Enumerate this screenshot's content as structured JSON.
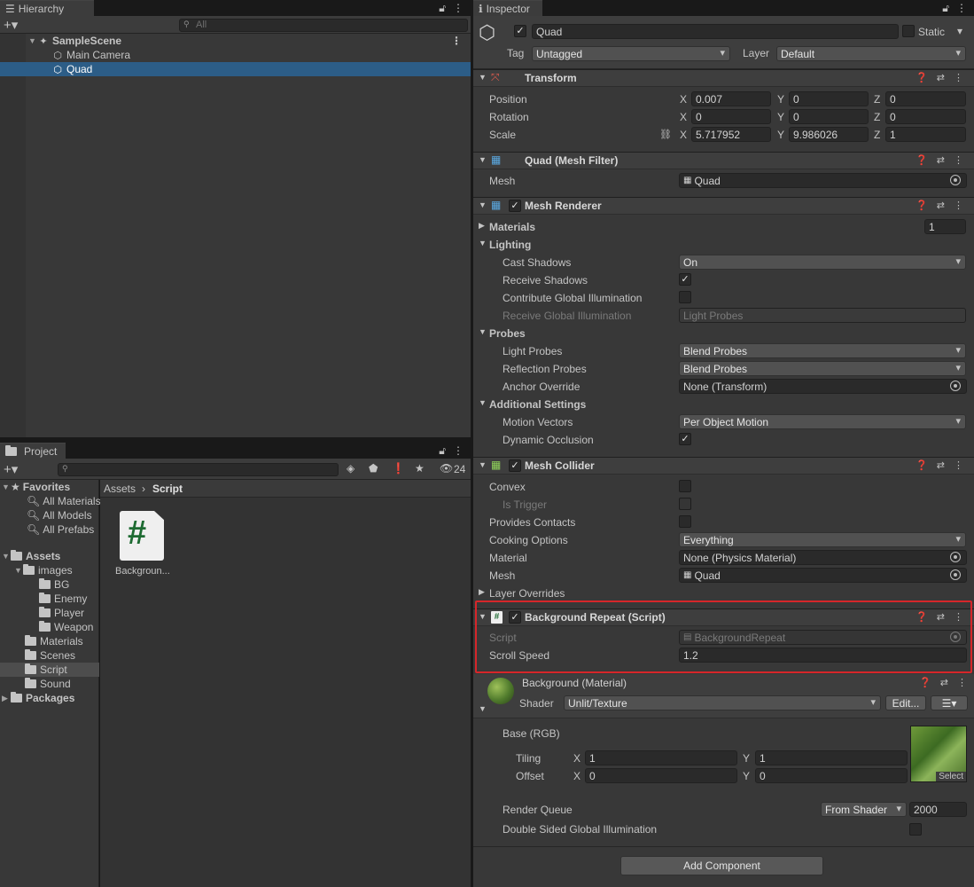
{
  "hierarchy": {
    "tab": "Hierarchy",
    "search_placeholder": "All",
    "scene": "SampleScene",
    "items": [
      "Main Camera",
      "Quad"
    ]
  },
  "project": {
    "tab": "Project",
    "hidden_count": "24",
    "favorites": {
      "label": "Favorites",
      "items": [
        "All Materials",
        "All Models",
        "All Prefabs"
      ]
    },
    "assets": {
      "label": "Assets",
      "images": {
        "label": "images",
        "items": [
          "BG",
          "Enemy",
          "Player",
          "Weapon"
        ]
      },
      "items": [
        "Materials",
        "Scenes",
        "Script",
        "Sound"
      ]
    },
    "packages": "Packages",
    "breadcrumb": [
      "Assets",
      "Script"
    ],
    "file": {
      "icon": "#",
      "name": "Backgroun..."
    }
  },
  "inspector": {
    "tab": "Inspector",
    "object_name": "Quad",
    "static_label": "Static",
    "tag_label": "Tag",
    "tag_value": "Untagged",
    "layer_label": "Layer",
    "layer_value": "Default",
    "transform": {
      "title": "Transform",
      "position": {
        "label": "Position",
        "x": "0.007",
        "y": "0",
        "z": "0"
      },
      "rotation": {
        "label": "Rotation",
        "x": "0",
        "y": "0",
        "z": "0"
      },
      "scale": {
        "label": "Scale",
        "x": "5.717952",
        "y": "9.986026",
        "z": "1"
      },
      "axis": [
        "X",
        "Y",
        "Z"
      ]
    },
    "mesh_filter": {
      "title": "Quad (Mesh Filter)",
      "mesh_label": "Mesh",
      "mesh_value": "Quad"
    },
    "mesh_renderer": {
      "title": "Mesh Renderer",
      "materials_label": "Materials",
      "materials_count": "1",
      "lighting": "Lighting",
      "cast_shadows_label": "Cast Shadows",
      "cast_shadows_value": "On",
      "receive_shadows_label": "Receive Shadows",
      "contribute_gi_label": "Contribute Global Illumination",
      "receive_gi_label": "Receive Global Illumination",
      "receive_gi_value": "Light Probes",
      "probes": "Probes",
      "light_probes_label": "Light Probes",
      "light_probes_value": "Blend Probes",
      "reflection_probes_label": "Reflection Probes",
      "reflection_probes_value": "Blend Probes",
      "anchor_override_label": "Anchor Override",
      "anchor_override_value": "None (Transform)",
      "additional_settings": "Additional Settings",
      "motion_vectors_label": "Motion Vectors",
      "motion_vectors_value": "Per Object Motion",
      "dynamic_occlusion_label": "Dynamic Occlusion"
    },
    "mesh_collider": {
      "title": "Mesh Collider",
      "convex_label": "Convex",
      "is_trigger_label": "Is Trigger",
      "provides_contacts_label": "Provides Contacts",
      "cooking_options_label": "Cooking Options",
      "cooking_options_value": "Everything",
      "material_label": "Material",
      "material_value": "None (Physics Material)",
      "mesh_label": "Mesh",
      "mesh_value": "Quad",
      "layer_overrides": "Layer Overrides"
    },
    "script": {
      "title": "Background Repeat (Script)",
      "script_label": "Script",
      "script_value": "BackgroundRepeat",
      "scroll_speed_label": "Scroll Speed",
      "scroll_speed_value": "1.2"
    },
    "material": {
      "title": "Background (Material)",
      "shader_label": "Shader",
      "shader_value": "Unlit/Texture",
      "edit_button": "Edit...",
      "base_label": "Base (RGB)",
      "tiling_label": "Tiling",
      "tiling_x": "1",
      "tiling_y": "1",
      "offset_label": "Offset",
      "offset_x": "0",
      "offset_y": "0",
      "select_label": "Select",
      "render_queue_label": "Render Queue",
      "render_queue_mode": "From Shader",
      "render_queue_value": "2000",
      "double_sided_gi_label": "Double Sided Global Illumination"
    },
    "add_component": "Add Component"
  },
  "colors": {
    "highlight": "#d6262a",
    "selection": "#2c5d87"
  }
}
